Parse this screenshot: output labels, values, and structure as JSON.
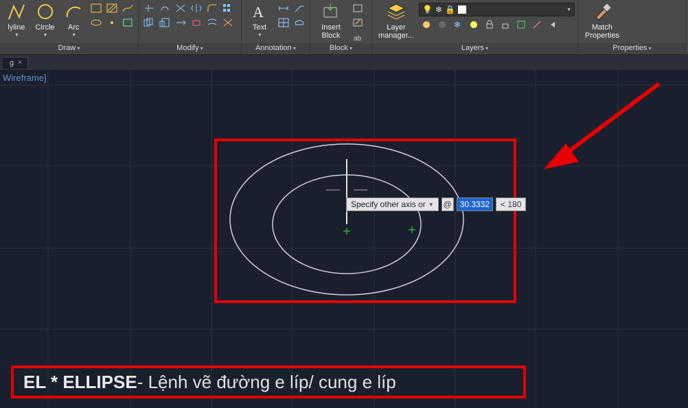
{
  "ribbon": {
    "panels": {
      "draw": {
        "label": "Draw",
        "polyline": "lyline",
        "circle": "Circle",
        "arc": "Arc"
      },
      "modify": {
        "label": "Modify"
      },
      "annotation": {
        "label": "Annotation",
        "text": "Text"
      },
      "block": {
        "label": "Block",
        "insert": "Insert\nBlock"
      },
      "layers": {
        "label": "Layers",
        "manager": "Layer\nmanager..."
      },
      "properties": {
        "label": "Properties",
        "match": "Match\nProperties"
      }
    }
  },
  "tab": {
    "name": "g",
    "close": "×"
  },
  "viewport": {
    "wireframe_label": "Wireframe]",
    "prompt": "Specify other axis or",
    "at": "@",
    "value": "30.3332",
    "angle_prefix": "<",
    "angle": "180"
  },
  "caption": {
    "bold": "EL * ELLIPSE",
    "rest": " - Lệnh vẽ đường e líp/ cung e líp"
  }
}
